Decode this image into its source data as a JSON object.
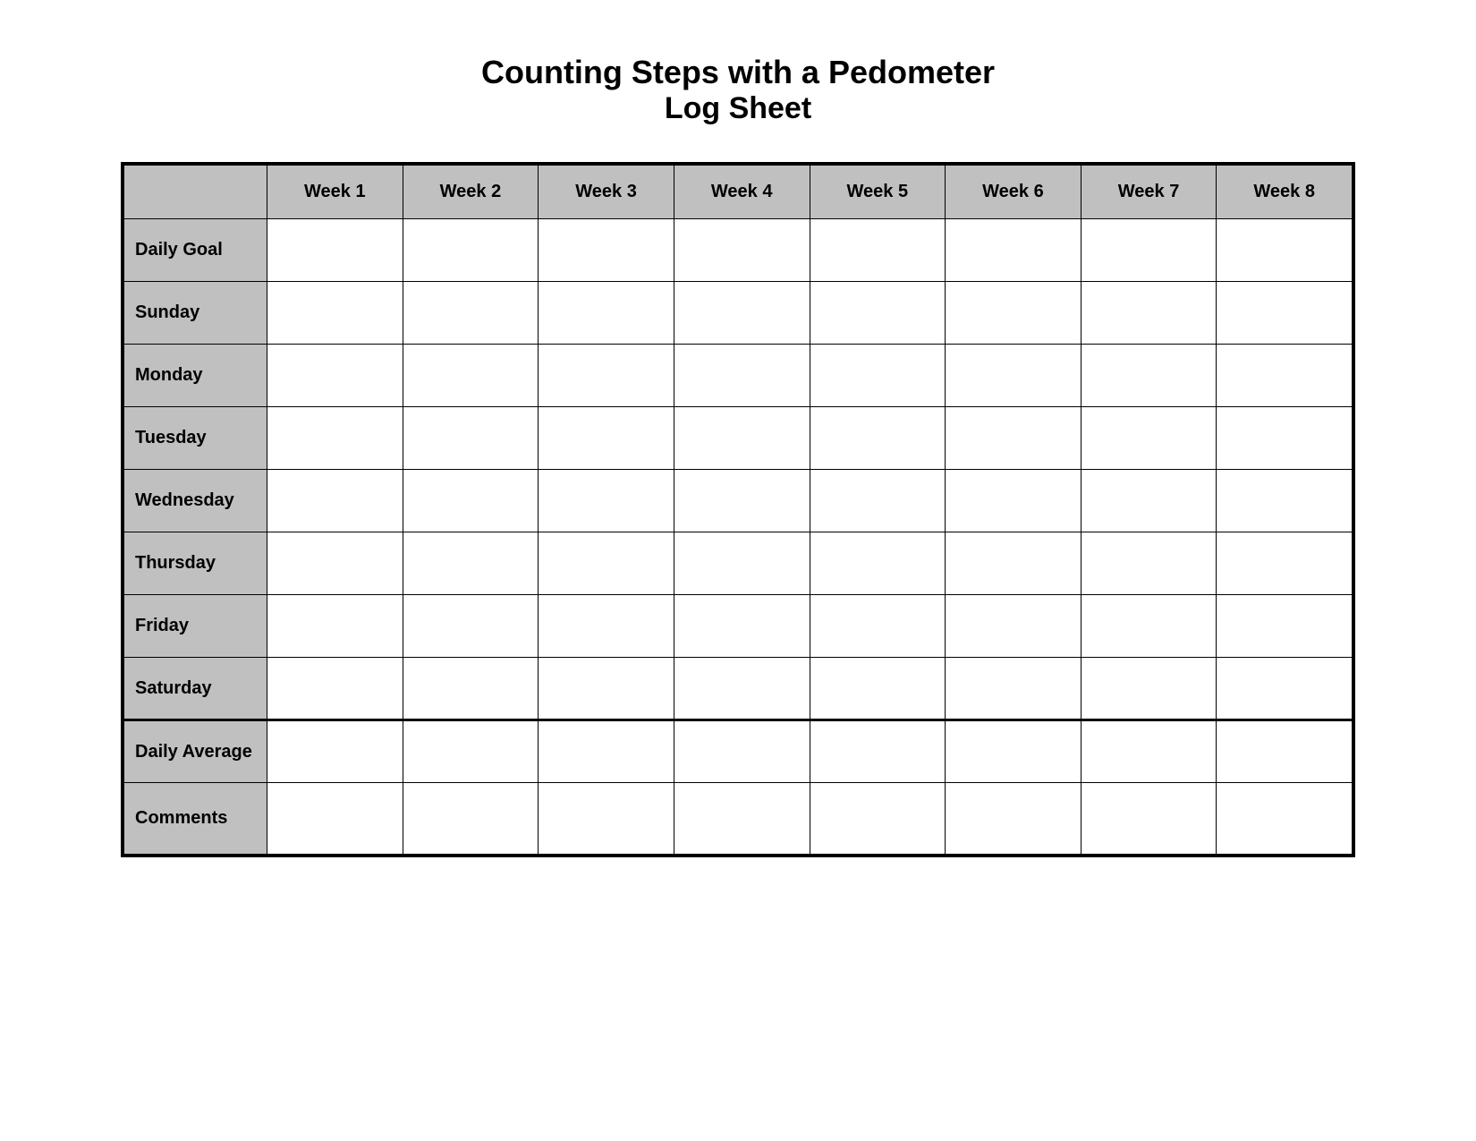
{
  "title": {
    "line1": "Counting Steps with a Pedometer",
    "line2": "Log Sheet"
  },
  "table": {
    "header": {
      "empty_col": "",
      "weeks": [
        "Week 1",
        "Week 2",
        "Week 3",
        "Week 4",
        "Week 5",
        "Week 6",
        "Week 7",
        "Week 8"
      ]
    },
    "rows": [
      {
        "label": "Daily Goal"
      },
      {
        "label": "Sunday"
      },
      {
        "label": "Monday"
      },
      {
        "label": "Tuesday"
      },
      {
        "label": "Wednesday"
      },
      {
        "label": "Thursday"
      },
      {
        "label": "Friday"
      },
      {
        "label": "Saturday"
      },
      {
        "label": "Daily Average"
      },
      {
        "label": "Comments"
      }
    ]
  }
}
